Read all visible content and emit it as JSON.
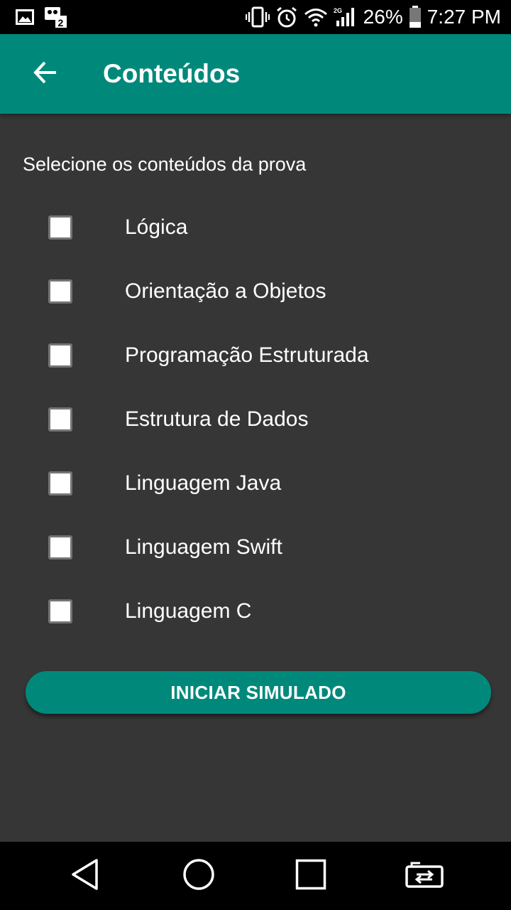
{
  "status_bar": {
    "battery_percent": "26%",
    "time": "7:27 PM",
    "network": "2G",
    "icons": [
      "image-icon",
      "sim-icon",
      "vibrate-icon",
      "alarm-icon",
      "wifi-icon",
      "signal-icon",
      "battery-icon"
    ]
  },
  "app_bar": {
    "title": "Conteúdos",
    "back_icon": "arrow-back-icon",
    "color": "#00897b"
  },
  "instruction": "Selecione os conteúdos da prova",
  "options": [
    {
      "label": "Lógica",
      "checked": false
    },
    {
      "label": "Orientação a Objetos",
      "checked": false
    },
    {
      "label": "Programação Estruturada",
      "checked": false
    },
    {
      "label": "Estrutura de Dados",
      "checked": false
    },
    {
      "label": "Linguagem Java",
      "checked": false
    },
    {
      "label": "Linguagem Swift",
      "checked": false
    },
    {
      "label": "Linguagem C",
      "checked": false
    }
  ],
  "start_button": {
    "label": "INICIAR SIMULADO",
    "color": "#00897b"
  },
  "nav_bar": {
    "icons": [
      "back-triangle-icon",
      "home-circle-icon",
      "recents-square-icon",
      "switch-sim-icon"
    ]
  },
  "colors": {
    "background": "#363636",
    "accent": "#00897b"
  }
}
